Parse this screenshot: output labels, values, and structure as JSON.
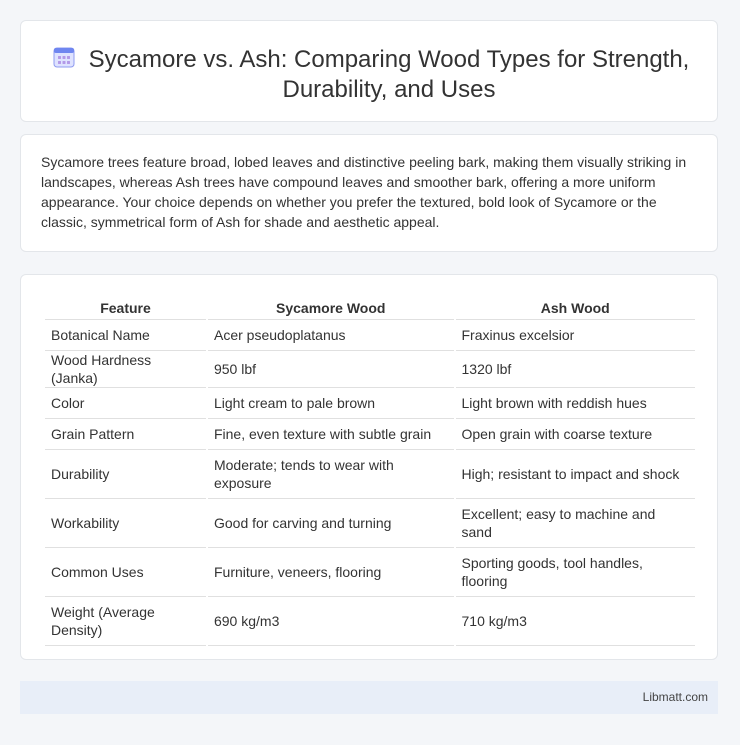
{
  "header": {
    "title": "Sycamore vs. Ash: Comparing Wood Types for Strength, Durability, and Uses",
    "icon": "calendar-icon"
  },
  "intro": {
    "text": "Sycamore trees feature broad, lobed leaves and distinctive peeling bark, making them visually striking in landscapes, whereas Ash trees have compound leaves and smoother bark, offering a more uniform appearance. Your choice depends on whether you prefer the textured, bold look of Sycamore or the classic, symmetrical form of Ash for shade and aesthetic appeal."
  },
  "table": {
    "headers": [
      "Feature",
      "Sycamore Wood",
      "Ash Wood"
    ],
    "rows": [
      [
        "Botanical Name",
        "Acer pseudoplatanus",
        "Fraxinus excelsior"
      ],
      [
        "Wood Hardness (Janka)",
        "950 lbf",
        "1320 lbf"
      ],
      [
        "Color",
        "Light cream to pale brown",
        "Light brown with reddish hues"
      ],
      [
        "Grain Pattern",
        "Fine, even texture with subtle grain",
        "Open grain with coarse texture"
      ],
      [
        "Durability",
        "Moderate; tends to wear with exposure",
        "High; resistant to impact and shock"
      ],
      [
        "Workability",
        "Good for carving and turning",
        "Excellent; easy to machine and sand"
      ],
      [
        "Common Uses",
        "Furniture, veneers, flooring",
        "Sporting goods, tool handles, flooring"
      ],
      [
        "Weight (Average Density)",
        "690 kg/m3",
        "710 kg/m3"
      ]
    ]
  },
  "footer": {
    "brand": "Libmatt.com"
  }
}
